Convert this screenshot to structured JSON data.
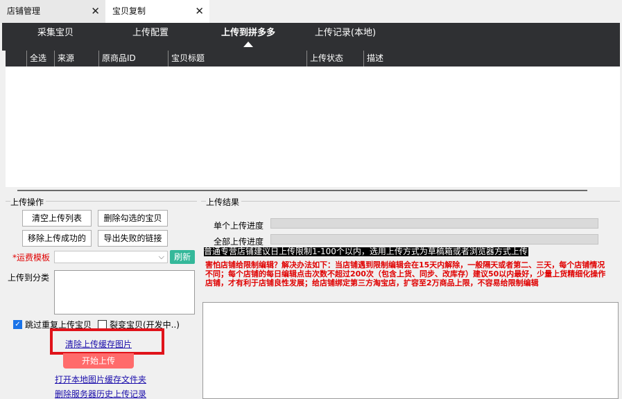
{
  "tabs": [
    {
      "label": "店铺管理",
      "close": "✕"
    },
    {
      "label": "宝贝复制",
      "close": "✕"
    }
  ],
  "nav": {
    "items": [
      "采集宝贝",
      "上传配置",
      "上传到拼多多",
      "上传记录(本地)"
    ],
    "active_index": 2
  },
  "table": {
    "headers": [
      "全选",
      "来源",
      "原商品ID",
      "宝贝标题",
      "上传状态",
      "描述"
    ],
    "rows": []
  },
  "upload_ops": {
    "group_label": "上传操作",
    "clear_list": "清空上传列表",
    "delete_checked": "删除勾选的宝贝",
    "remove_success": "移除上传成功的",
    "export_failed": "导出失败的链接",
    "shipping_required_mark": "*",
    "shipping_label": "运费模板",
    "shipping_value": "",
    "refresh": "刷新",
    "category_label": "上传到分类",
    "category_value": "",
    "skip_dup_label": "跳过重复上传宝贝",
    "skip_dup_checked": true,
    "split_label": "裂变宝贝(开发中..)",
    "split_checked": false,
    "clear_cache_images": "清除上传缓存图片",
    "start_upload": "开始上传",
    "open_local_cache": "打开本地图片缓存文件夹",
    "delete_server_history": "删除服务器历史上传记录"
  },
  "upload_result": {
    "group_label": "上传结果",
    "single_progress_label": "单个上传进度",
    "single_progress": 0,
    "all_progress_label": "全部上传进度",
    "all_progress": 0,
    "notice": "普通专营店铺建议日上传限制1-100个以内，选用上传方式为草稿箱或者浏览器方式上传",
    "warning": "害怕店铺给限制编辑？解决办法如下：当店铺遇到限制编辑会在15天内解除，一般隔天或者第二、三天，每个店铺情况不同；每个店铺的每日编辑点击次数不超过200次（包含上货、同步、改库存）建议50以内最好，少量上货精细化操作店铺，才有利于店铺良性发展；给店铺绑定第三方淘宝店，扩容至2万商品上限，不容易给限制编辑",
    "log": ""
  },
  "colors": {
    "nav_bg": "#2f3033",
    "refresh_bg": "#34b89a",
    "start_bg": "#ff6b6b",
    "highlight_border": "#e0131a",
    "warning_text": "#e00000"
  }
}
